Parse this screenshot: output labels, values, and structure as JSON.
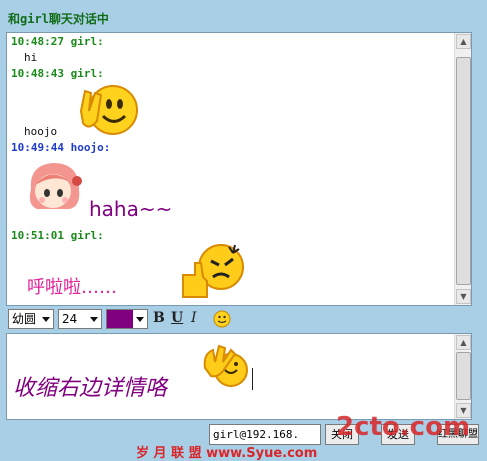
{
  "window": {
    "title": "和girl聊天对话中"
  },
  "chat": {
    "messages": [
      {
        "header": "10:48:27 girl:",
        "text": "hi"
      },
      {
        "header": "10:48:43 girl:",
        "text": "hoojo"
      },
      {
        "header": "10:49:44 hoojo:",
        "text": "haha~~"
      },
      {
        "header": "10:51:01 girl:",
        "text": "呼啦啦……"
      }
    ]
  },
  "toolbar": {
    "font_value": "幼圆",
    "size_value": "24",
    "color": "#800080",
    "bold_label": "B",
    "underline_label": "U",
    "italic_label": "I"
  },
  "input": {
    "text": "收缩右边详情咯"
  },
  "footer": {
    "address_value": "girl@192.168.",
    "close_label": "关闭",
    "send_label": "发送",
    "extra_label": "红黑聊盟"
  },
  "watermark": {
    "site_logo": "2cto.com",
    "site_text": "岁 月 联 盟  www.Syue.com"
  },
  "colors": {
    "girl_header": "#1a8a1a",
    "hoojo_header": "#1f3cc8",
    "styled_text": "#800080",
    "rainbow_text": "#e0209a"
  },
  "icons": [
    "smiley-victory-icon",
    "anime-girl-icon",
    "smiley-thumbsup-icon",
    "smiley-toolbar-icon",
    "smiley-ok-icon"
  ]
}
